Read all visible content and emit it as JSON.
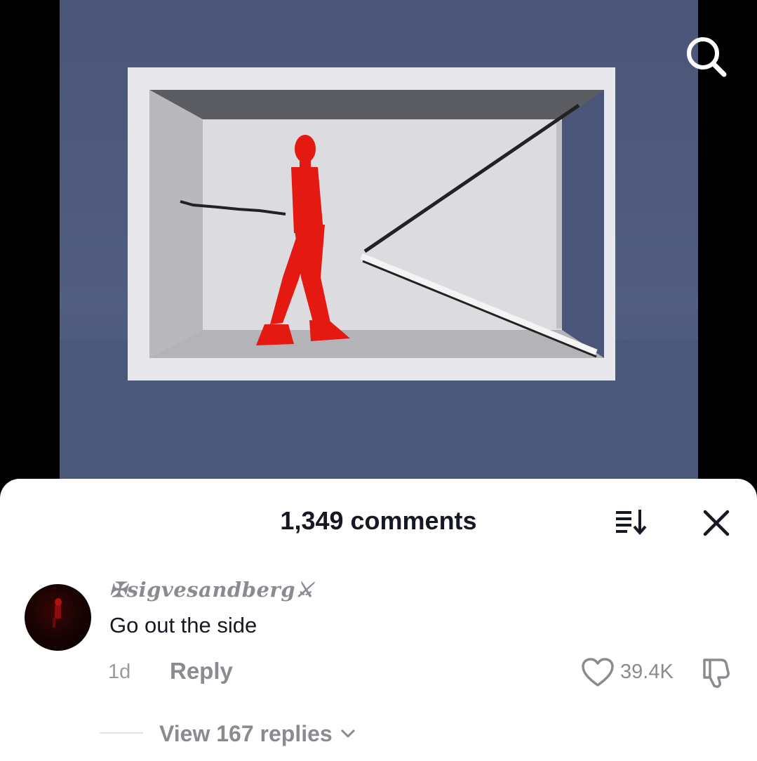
{
  "video": {
    "search_icon": "search-icon",
    "colors": {
      "background": "#4d5880",
      "figure": "#e41a12",
      "room": "#d6d6da"
    }
  },
  "comments_panel": {
    "title": "1,349 comments",
    "sort_icon": "sort-icon",
    "close_icon": "close-icon"
  },
  "comment": {
    "username": "✠sigvesandberg⚔",
    "text": "Go out the side",
    "time": "1d",
    "reply_label": "Reply",
    "likes": "39.4K",
    "like_icon": "heart-icon",
    "dislike_icon": "thumbs-down-icon",
    "view_replies_label": "View 167 replies"
  }
}
